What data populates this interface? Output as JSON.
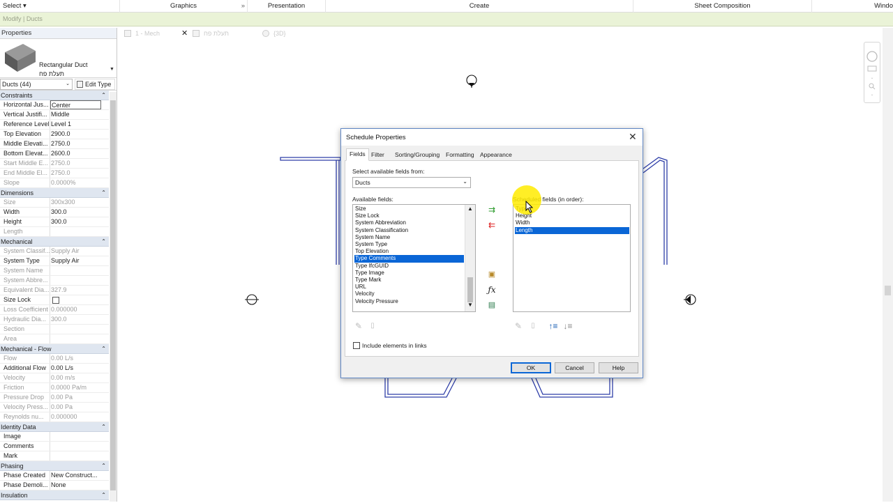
{
  "ribbon": {
    "tabs": [
      "Select",
      "Graphics",
      "Presentation",
      "Create",
      "Sheet Composition",
      "Windo"
    ],
    "select_caret": "▾",
    "graphics_expander": "»"
  },
  "context_bar": {
    "text": "Modify | Ducts"
  },
  "properties": {
    "title": "Properties",
    "type_name": "Rectangular Duct",
    "type_subname": "תעלת פח",
    "instance_selector": "Ducts (44)",
    "edit_type_label": "Edit Type",
    "sections": [
      {
        "name": "Constraints",
        "rows": [
          {
            "k": "Horizontal Jus...",
            "v": "Center",
            "enabled": true,
            "boxed": true
          },
          {
            "k": "Vertical Justifi...",
            "v": "Middle",
            "enabled": true
          },
          {
            "k": "Reference Level",
            "v": "Level 1",
            "enabled": true
          },
          {
            "k": "Top Elevation",
            "v": "2900.0",
            "enabled": true
          },
          {
            "k": "Middle Elevati...",
            "v": "2750.0",
            "enabled": true
          },
          {
            "k": "Bottom Elevat...",
            "v": "2600.0",
            "enabled": true
          },
          {
            "k": "Start Middle E...",
            "v": "2750.0",
            "enabled": false
          },
          {
            "k": "End Middle El...",
            "v": "2750.0",
            "enabled": false
          },
          {
            "k": "Slope",
            "v": "0.0000%",
            "enabled": false
          }
        ]
      },
      {
        "name": "Dimensions",
        "rows": [
          {
            "k": "Size",
            "v": "300x300",
            "enabled": false
          },
          {
            "k": "Width",
            "v": "300.0",
            "enabled": true
          },
          {
            "k": "Height",
            "v": "300.0",
            "enabled": true
          },
          {
            "k": "Length",
            "v": "",
            "enabled": false
          }
        ]
      },
      {
        "name": "Mechanical",
        "rows": [
          {
            "k": "System Classif...",
            "v": "Supply Air",
            "enabled": false
          },
          {
            "k": "System Type",
            "v": "Supply Air",
            "enabled": true
          },
          {
            "k": "System Name",
            "v": "",
            "enabled": false
          },
          {
            "k": "System Abbre...",
            "v": "",
            "enabled": false
          },
          {
            "k": "Equivalent Dia...",
            "v": "327.9",
            "enabled": false
          },
          {
            "k": "Size Lock",
            "v": "",
            "enabled": true,
            "checkbox": true
          },
          {
            "k": "Loss Coefficient",
            "v": "0.000000",
            "enabled": false
          },
          {
            "k": "Hydraulic Dia...",
            "v": "300.0",
            "enabled": false
          },
          {
            "k": "Section",
            "v": "",
            "enabled": false
          },
          {
            "k": "Area",
            "v": "",
            "enabled": false
          }
        ]
      },
      {
        "name": "Mechanical - Flow",
        "rows": [
          {
            "k": "Flow",
            "v": "0.00 L/s",
            "enabled": false
          },
          {
            "k": "Additional Flow",
            "v": "0.00 L/s",
            "enabled": true
          },
          {
            "k": "Velocity",
            "v": "0.00 m/s",
            "enabled": false
          },
          {
            "k": "Friction",
            "v": "0.0000 Pa/m",
            "enabled": false
          },
          {
            "k": "Pressure Drop",
            "v": "0.00 Pa",
            "enabled": false
          },
          {
            "k": "Velocity Press...",
            "v": "0.00 Pa",
            "enabled": false
          },
          {
            "k": "Reynolds nu...",
            "v": "0.000000",
            "enabled": false
          }
        ]
      },
      {
        "name": "Identity Data",
        "rows": [
          {
            "k": "Image",
            "v": "",
            "enabled": true
          },
          {
            "k": "Comments",
            "v": "",
            "enabled": true
          },
          {
            "k": "Mark",
            "v": "",
            "enabled": true
          }
        ]
      },
      {
        "name": "Phasing",
        "rows": [
          {
            "k": "Phase Created",
            "v": "New Construct...",
            "enabled": true
          },
          {
            "k": "Phase Demoli...",
            "v": "None",
            "enabled": true
          }
        ]
      },
      {
        "name": "Insulation",
        "rows": []
      }
    ]
  },
  "view_tabs": [
    {
      "label": "1 - Mech",
      "active": true
    },
    {
      "label": "תעלת פח",
      "active": false
    },
    {
      "label": "{3D}",
      "active": false
    }
  ],
  "dialog": {
    "title": "Schedule Properties",
    "tabs": [
      "Fields",
      "Filter",
      "Sorting/Grouping",
      "Formatting",
      "Appearance"
    ],
    "select_from_label": "Select available fields from:",
    "select_from_value": "Ducts",
    "available_label": "Available fields:",
    "available_fields": [
      "Size",
      "Size Lock",
      "System Abbreviation",
      "System Classification",
      "System Name",
      "System Type",
      "Top Elevation",
      "Type Comments",
      "Type IfcGUID",
      "Type Image",
      "Type Mark",
      "URL",
      "Velocity",
      "Velocity Pressure"
    ],
    "available_selected": "Type Comments",
    "scheduled_label": "Scheduled fields (in order):",
    "scheduled_fields": [
      "Type",
      "Height",
      "Width",
      "Length"
    ],
    "scheduled_selected": "Length",
    "include_links_label": "Include elements in links",
    "buttons": {
      "ok": "OK",
      "cancel": "Cancel",
      "help": "Help"
    }
  },
  "colors": {
    "accent": "#0a66d6",
    "context_bar": "#eaf3d7",
    "section_header": "#dfe6f0",
    "cursor_highlight": "#ffeb00"
  }
}
